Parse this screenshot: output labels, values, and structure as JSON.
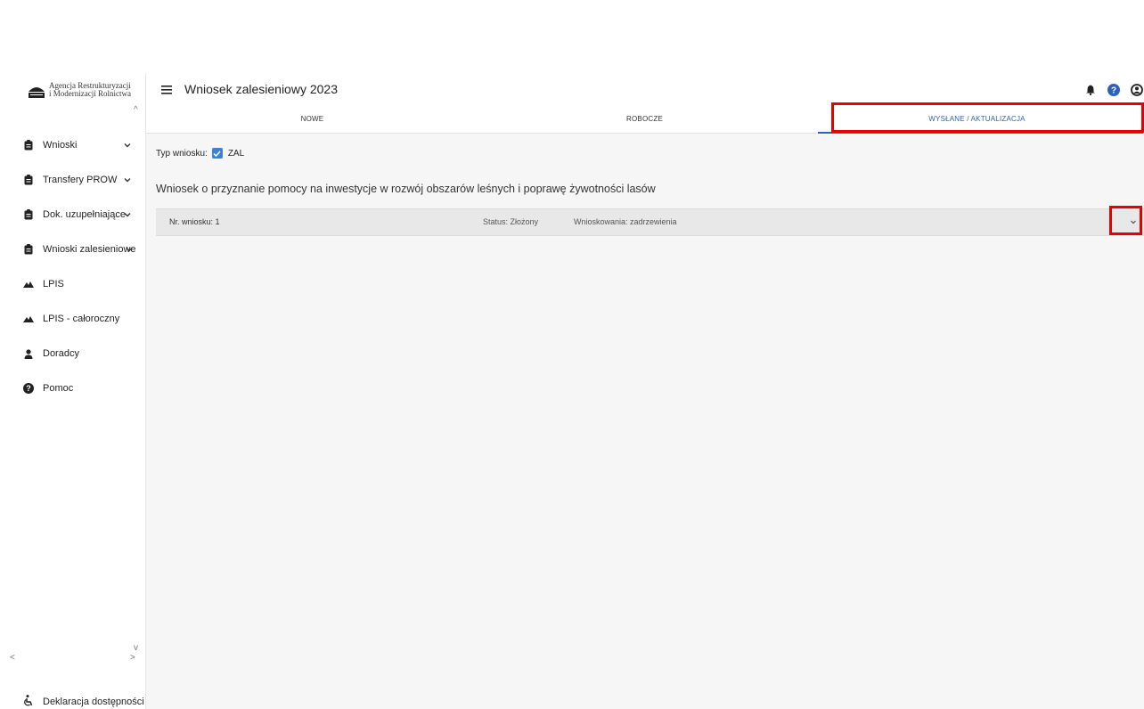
{
  "sidebar": {
    "logo_line1": "Agencja Restrukturyzacji",
    "logo_line2": "i Modernizacji Rolnictwa",
    "items": [
      {
        "label": "Wnioski",
        "icon": "clipboard-icon",
        "has_chevron": true
      },
      {
        "label": "Transfery PROW",
        "icon": "clipboard-icon",
        "has_chevron": true
      },
      {
        "label": "Dok. uzupełniające",
        "icon": "clipboard-icon",
        "has_chevron": true
      },
      {
        "label": "Wnioski zalesieniowe",
        "icon": "clipboard-icon",
        "has_chevron": true
      },
      {
        "label": "LPIS",
        "icon": "mountain-icon",
        "has_chevron": false
      },
      {
        "label": "LPIS - całoroczny",
        "icon": "mountain-icon",
        "has_chevron": false
      },
      {
        "label": "Doradcy",
        "icon": "person-icon",
        "has_chevron": false
      },
      {
        "label": "Pomoc",
        "icon": "help-circle-icon",
        "has_chevron": false
      }
    ],
    "footer_label": "Deklaracja dostępności"
  },
  "header": {
    "title": "Wniosek zalesieniowy 2023"
  },
  "tabs": [
    {
      "label": "NOWE"
    },
    {
      "label": "ROBOCZE"
    },
    {
      "label": "WYSŁANE / AKTUALIZACJA"
    }
  ],
  "main": {
    "filter_label": "Typ wniosku:",
    "filter_value": "ZAL",
    "section_title": "Wniosek o przyznanie pomocy na inwestycje w rozwój obszarów leśnych i poprawę żywotności lasów",
    "row": {
      "number": "Nr. wniosku: 1",
      "status": "Status: Złożony",
      "requests": "Wnioskowania: zadrzewienia"
    }
  },
  "colors": {
    "accent": "#2c62b8",
    "highlight": "#e60000",
    "checkbox": "#3b82d6"
  }
}
